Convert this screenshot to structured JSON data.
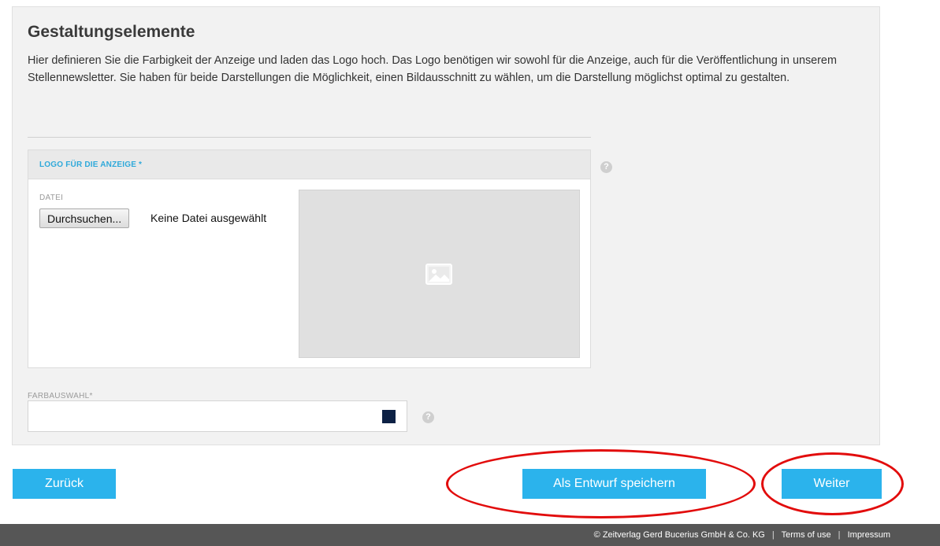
{
  "section": {
    "title": "Gestaltungselemente",
    "intro": "Hier definieren Sie die Farbigkeit der Anzeige und laden das Logo hoch. Das Logo benötigen wir sowohl für die Anzeige, auch für die Veröffentlichung in unserem Stellennewsletter. Sie haben für beide Darstellungen die Möglichkeit, einen Bildausschnitt zu wählen, um die Darstellung möglichst optimal zu gestalten."
  },
  "logo_card": {
    "header": "LOGO FÜR DIE ANZEIGE *",
    "file_label": "DATEI",
    "browse_button": "Durchsuchen...",
    "file_status": "Keine Datei ausgewählt"
  },
  "color_picker": {
    "label": "FARBAUSWAHL*",
    "value": "",
    "swatch_color": "#0d2145"
  },
  "help_icon_glyph": "?",
  "actions": {
    "back_label": "Zurück",
    "draft_label": "Als Entwurf speichern",
    "next_label": "Weiter"
  },
  "footer": {
    "copyright": "© Zeitverlag Gerd Bucerius GmbH & Co. KG",
    "terms": "Terms of use",
    "imprint": "Impressum",
    "separator": "|"
  },
  "colors": {
    "accent": "#2bb3ec",
    "highlight": "#e20c0c",
    "footer_bg": "#565656"
  }
}
